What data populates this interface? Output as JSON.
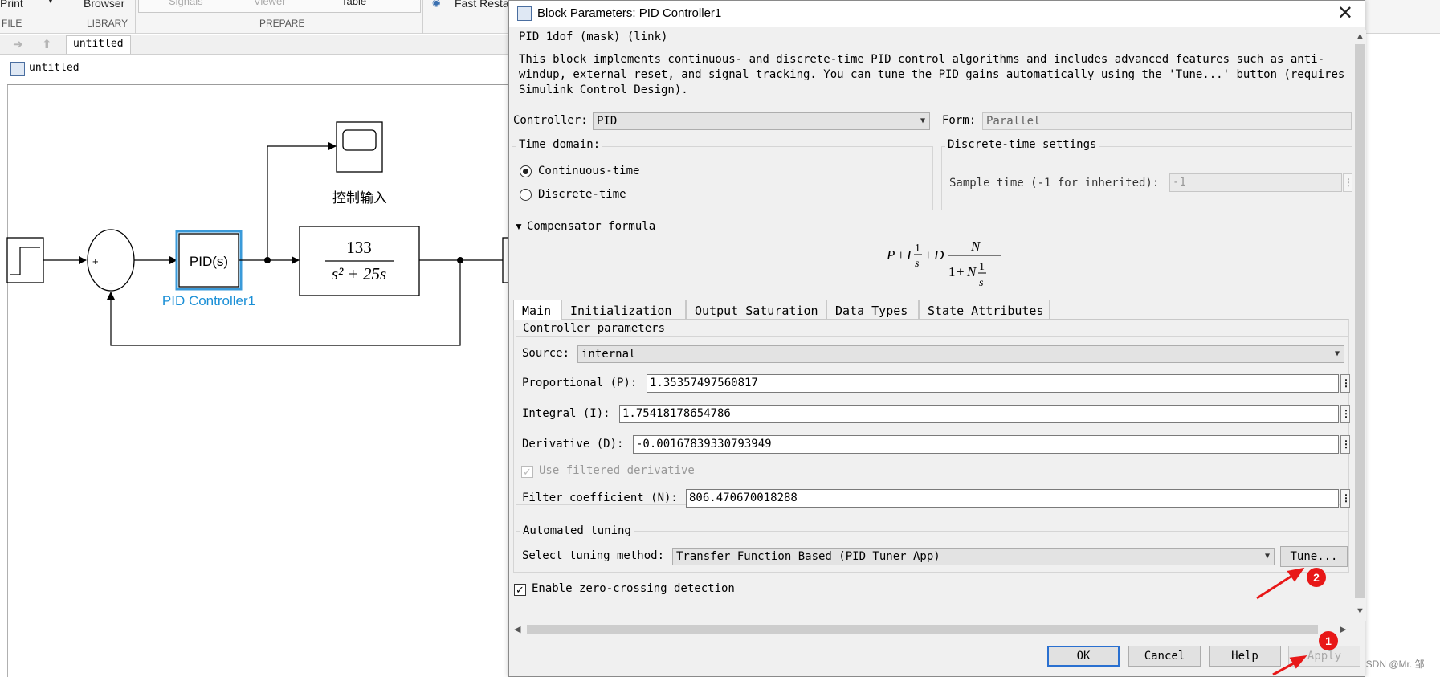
{
  "toolstrip": {
    "print_label": "Print",
    "browser_label": "Browser",
    "file_section": "FILE",
    "library_section": "LIBRARY",
    "prepare_section": "PREPARE",
    "signals_label": "Signals",
    "viewer_label": "Viewer",
    "table_label": "Table",
    "fast_restart_label": "Fast Resta"
  },
  "nav": {
    "tab_label": "untitled",
    "address": "untitled"
  },
  "model": {
    "pid_block_text": "PID(s)",
    "pid_block_name": "PID Controller1",
    "tf_numerator": "133",
    "tf_denominator": "s² + 25s",
    "scope_caption": "控制输入",
    "sum_plus": "+",
    "sum_minus": "−"
  },
  "dialog": {
    "title": "Block Parameters: PID Controller1",
    "header": "PID 1dof (mask) (link)",
    "description_lines": [
      "This block implements continuous- and discrete-time PID control algorithms and includes advanced features such as anti-",
      "windup, external reset, and signal tracking. You can tune the PID gains automatically using the 'Tune...' button (requires",
      "Simulink Control Design)."
    ],
    "controller_label": "Controller:",
    "controller_value": "PID",
    "form_label": "Form:",
    "form_value": "Parallel",
    "time_domain_title": "Time domain:",
    "continuous_label": "Continuous-time",
    "discrete_label": "Discrete-time",
    "discrete_settings_title": "Discrete-time settings",
    "sample_time_label": "Sample time (-1 for inherited):",
    "sample_time_value": "-1",
    "compensator_label": "Compensator formula",
    "tabs": [
      "Main",
      "Initialization",
      "Output Saturation",
      "Data Types",
      "State Attributes"
    ],
    "controller_params_title": "Controller parameters",
    "source_label": "Source:",
    "source_value": "internal",
    "p_label": "Proportional (P):",
    "p_value": "1.35357497560817",
    "i_label": "Integral (I):",
    "i_value": "1.75418178654786",
    "d_label": "Derivative (D):",
    "d_value": "-0.00167839330793949",
    "filtered_label": "Use filtered derivative",
    "n_label": "Filter coefficient (N):",
    "n_value": "806.470670018288",
    "auto_tuning_title": "Automated tuning",
    "tuning_method_label": "Select tuning method:",
    "tuning_method_value": "Transfer Function Based (PID Tuner App)",
    "tune_button": "Tune...",
    "zero_crossing_label": "Enable zero-crossing detection",
    "ok_button": "OK",
    "cancel_button": "Cancel",
    "help_button": "Help",
    "apply_button": "Apply"
  },
  "annotations": {
    "badge_1": "1",
    "badge_2": "2",
    "annotation_color": "#e81818"
  },
  "watermark": "CSDN @Mr. 邹",
  "colors": {
    "selected_block": "#3a9ad9",
    "pid_name_color": "#1a8fd6"
  }
}
